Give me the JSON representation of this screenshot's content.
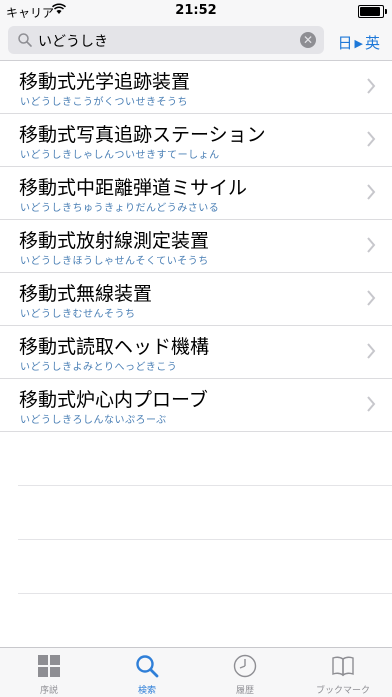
{
  "status_bar": {
    "carrier": "キャリア",
    "time": "21:52"
  },
  "search": {
    "value": "いどうしき",
    "lang_from": "日",
    "lang_to": "英"
  },
  "results": [
    {
      "title": "移動式光学追跡装置",
      "reading": "いどうしきこうがくついせきそうち"
    },
    {
      "title": "移動式写真追跡ステーション",
      "reading": "いどうしきしゃしんついせきすてーしょん"
    },
    {
      "title": "移動式中距離弾道ミサイル",
      "reading": "いどうしきちゅうきょりだんどうみさいる"
    },
    {
      "title": "移動式放射線測定装置",
      "reading": "いどうしきほうしゃせんそくていそうち"
    },
    {
      "title": "移動式無線装置",
      "reading": "いどうしきむせんそうち"
    },
    {
      "title": "移動式読取ヘッド機構",
      "reading": "いどうしきよみとりへっどきこう"
    },
    {
      "title": "移動式炉心内プローブ",
      "reading": "いどうしきろしんないぷろーぶ"
    }
  ],
  "tabs": [
    {
      "label": "序説",
      "icon": "grid-icon"
    },
    {
      "label": "検索",
      "icon": "search-icon"
    },
    {
      "label": "履歴",
      "icon": "clock-icon"
    },
    {
      "label": "ブックマーク",
      "icon": "book-icon"
    }
  ],
  "colors": {
    "accent": "#2f7fd8",
    "reading_text": "#4a7fb5",
    "inactive": "#8e8e93"
  }
}
